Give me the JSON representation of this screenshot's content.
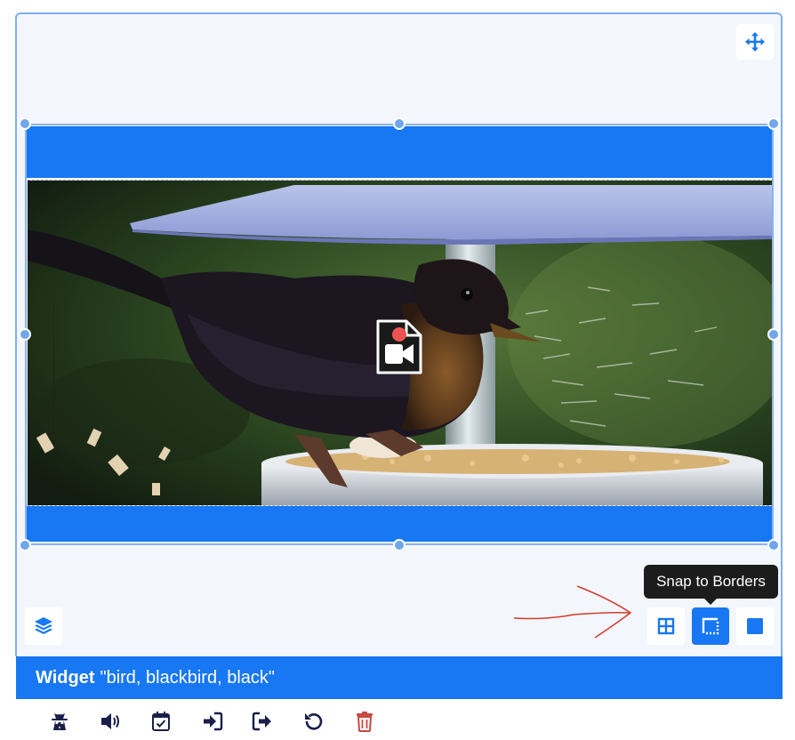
{
  "canvas": {
    "move_icon": "move-arrows-icon",
    "layers_icon": "layers-icon",
    "video_badge_icon": "video-file-icon"
  },
  "snap_controls": {
    "tooltip": "Snap to Borders",
    "options": [
      {
        "name": "snap-to-grid",
        "icon": "grid-icon",
        "active": false
      },
      {
        "name": "snap-to-borders",
        "icon": "borders-icon",
        "active": true
      },
      {
        "name": "snap-off",
        "icon": "square-icon",
        "active": false
      }
    ]
  },
  "widget_bar": {
    "label": "Widget",
    "title": "\"bird, blackbird, black\""
  },
  "toolbar": {
    "tools": [
      "incognito-icon",
      "volume-icon",
      "calendar-check-icon",
      "sign-in-icon",
      "sign-out-icon",
      "undo-icon",
      "trash-icon"
    ]
  },
  "colors": {
    "accent": "#1877f2",
    "canvas_bg": "#f3f7fd",
    "handle": "#6fa6ec",
    "danger": "#c94a40",
    "tool_icon": "#1a1f4a",
    "annotation_arrow": "#d83a2c"
  }
}
